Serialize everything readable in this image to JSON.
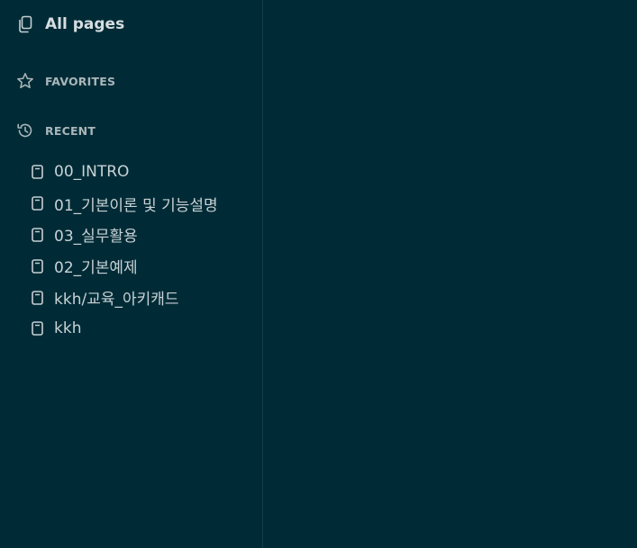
{
  "sidebar": {
    "all_pages": {
      "label": "All pages",
      "icon": "copy-pages-icon"
    },
    "favorites": {
      "label": "FAVORITES",
      "icon": "star-icon"
    },
    "recent": {
      "label": "RECENT",
      "icon": "history-icon",
      "items": [
        {
          "label": "00_INTRO",
          "icon": "document-icon"
        },
        {
          "label": "01_기본이론 및 기능설명",
          "icon": "document-icon"
        },
        {
          "label": "03_실무활용",
          "icon": "document-icon"
        },
        {
          "label": "02_기본예제",
          "icon": "document-icon"
        },
        {
          "label": "kkh/교육_아키캐드",
          "icon": "document-icon"
        },
        {
          "label": "kkh",
          "icon": "document-icon"
        }
      ]
    }
  },
  "colors": {
    "background": "#002b36",
    "divider": "#0f3e49",
    "text_primary": "#d6dde0",
    "text_secondary": "#a9b6ba"
  }
}
